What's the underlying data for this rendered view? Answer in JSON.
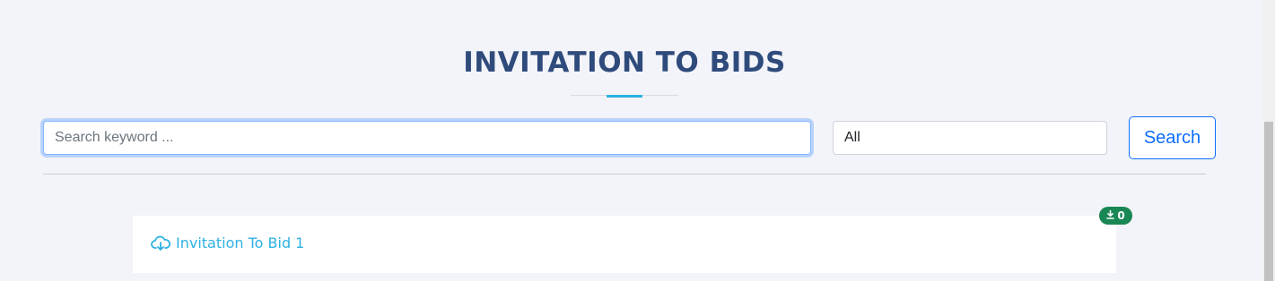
{
  "header": {
    "title": "INVITATION TO BIDS"
  },
  "search": {
    "placeholder": "Search keyword ...",
    "value": "",
    "filter_selected": "All",
    "button_label": "Search"
  },
  "results": [
    {
      "title": "Invitation To Bid 1",
      "icon": "cloud-download-icon",
      "download_count": "0"
    }
  ],
  "colors": {
    "title": "#2f4b7c",
    "accent": "#2eb1e3",
    "primary": "#0d6efd",
    "badge": "#198754",
    "background": "#f3f4f9"
  }
}
